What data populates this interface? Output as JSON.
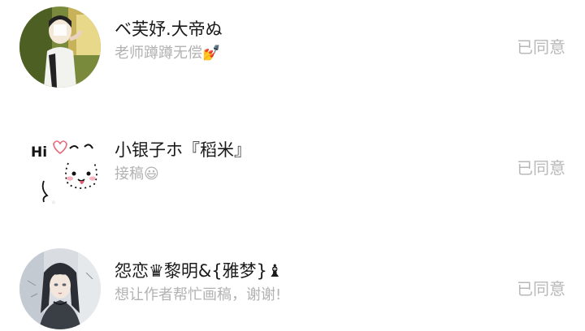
{
  "requests": [
    {
      "name": "ベ芙妤.大帝ぬ",
      "message": "老师蹲蹲无偿💅",
      "status": "已同意",
      "avatar_icon": "girl-photo-avatar"
    },
    {
      "name": "小银子ホ『稻米』",
      "message": "接稿😃",
      "status": "已同意",
      "avatar_icon": "cartoon-dog-avatar"
    },
    {
      "name": "怨恋♛黎明&{雅梦}♝",
      "message": "想让作者帮忙画稿，谢谢!",
      "status": "已同意",
      "avatar_icon": "anime-girl-avatar"
    }
  ],
  "colors": {
    "name": "#1a1a1a",
    "subtext": "#b2b2b2",
    "status": "#b8b8b8"
  }
}
